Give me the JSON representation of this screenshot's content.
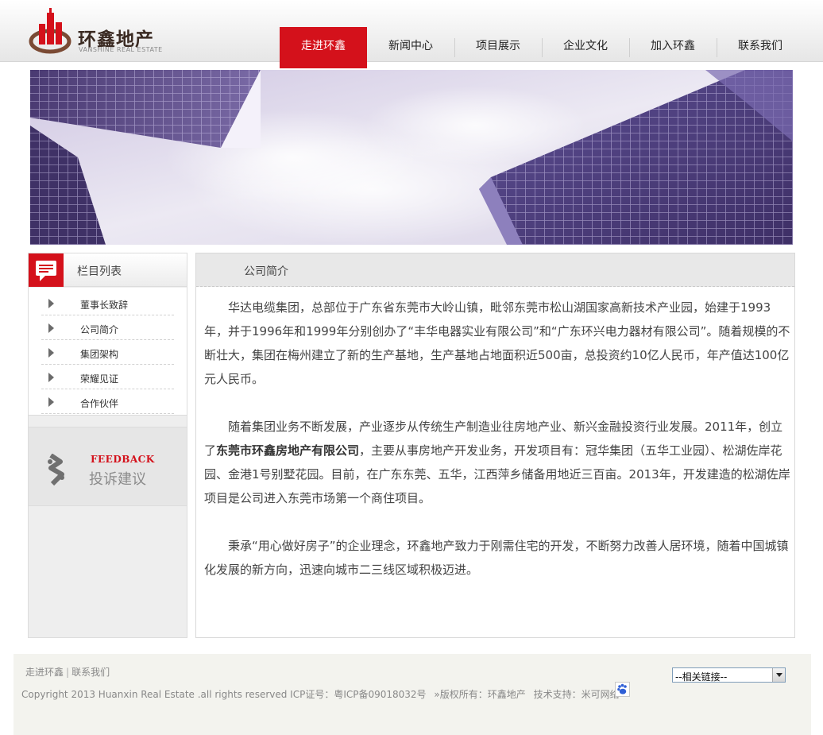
{
  "brand": {
    "name_cn": "环鑫地产",
    "name_en": "VANSHINE REAL ESTATE",
    "primary_color": "#d4111b",
    "logo_brown": "#7a4a34"
  },
  "nav": {
    "items": [
      {
        "label": "走进环鑫",
        "active": true
      },
      {
        "label": "新闻中心",
        "active": false
      },
      {
        "label": "项目展示",
        "active": false
      },
      {
        "label": "企业文化",
        "active": false
      },
      {
        "label": "加入环鑫",
        "active": false
      },
      {
        "label": "联系我们",
        "active": false
      }
    ]
  },
  "sidebar": {
    "title": "栏目列表",
    "items": [
      {
        "label": "董事长致辞"
      },
      {
        "label": "公司简介"
      },
      {
        "label": "集团架构"
      },
      {
        "label": "荣耀见证"
      },
      {
        "label": "合作伙伴"
      }
    ],
    "feedback": {
      "en": "FEEDBACK",
      "cn": "投诉建议"
    }
  },
  "content": {
    "title": "公司简介",
    "p1": "华达电缆集团，总部位于广东省东莞市大岭山镇，毗邻东莞市松山湖国家高新技术产业园，始建于1993年，并于1996年和1999年分别创办了“丰华电器实业有限公司”和“广东环兴电力器材有限公司”。随着规模的不断壮大，集团在梅州建立了新的生产基地，生产基地占地面积近500亩，总投资约10亿人民币，年产值达100亿元人民币。",
    "p2_before": "随着集团业务不断发展，产业逐步从传统生产制造业往房地产业、新兴金融投资行业发展。2011年，创立了",
    "p2_company": "东莞市环鑫房地产有限公司",
    "p2_after": "，主要从事房地产开发业务，开发项目有：冠华集团（五华工业园）、松湖佐岸花园、金港1号别墅花园。目前，在广东东莞、五华，江西萍乡储备用地近三百亩。2013年，开发建造的松湖佐岸项目是公司进入东莞市场第一个商住项目。",
    "p3": "秉承“用心做好房子”的企业理念，环鑫地产致力于刚需住宅的开发，不断努力改善人居环境，随着中国城镇化发展的新方向，迅速向城市二三线区域积极迈进。"
  },
  "footer": {
    "links": [
      "走进环鑫",
      "联系我们"
    ],
    "separator": "|",
    "copyright": "Copyright 2013 Huanxin Real Estate .all rights reserved ICP证号：粤ICP备09018032号",
    "owner": "»版权所有：环鑫地产",
    "support": "技术支持：米可网络",
    "select_value": "--相关链接--"
  }
}
